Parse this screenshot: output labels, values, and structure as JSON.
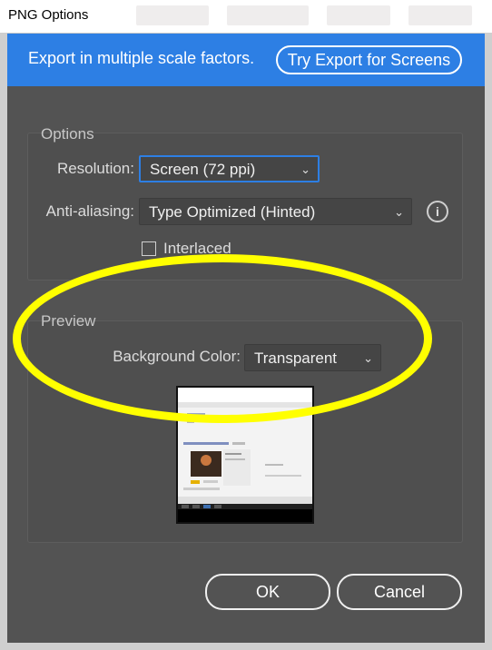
{
  "window": {
    "title": "PNG Options"
  },
  "banner": {
    "text": "Export in multiple scale factors.",
    "button_label": "Try Export for Screens"
  },
  "options": {
    "group_label": "Options",
    "resolution_label": "Resolution:",
    "resolution_value": "Screen (72 ppi)",
    "antialias_label": "Anti-aliasing:",
    "antialias_value": "Type Optimized (Hinted)",
    "interlaced_label": "Interlaced",
    "interlaced_checked": false
  },
  "preview": {
    "group_label": "Preview",
    "bg_label": "Background Color:",
    "bg_value": "Transparent"
  },
  "footer": {
    "ok_label": "OK",
    "cancel_label": "Cancel"
  },
  "colors": {
    "accent": "#2d7fe4",
    "dialog_bg": "#535353",
    "highlight": "#ffff00"
  },
  "icons": {
    "info": "info-icon",
    "dropdown": "chevron-down-icon"
  }
}
